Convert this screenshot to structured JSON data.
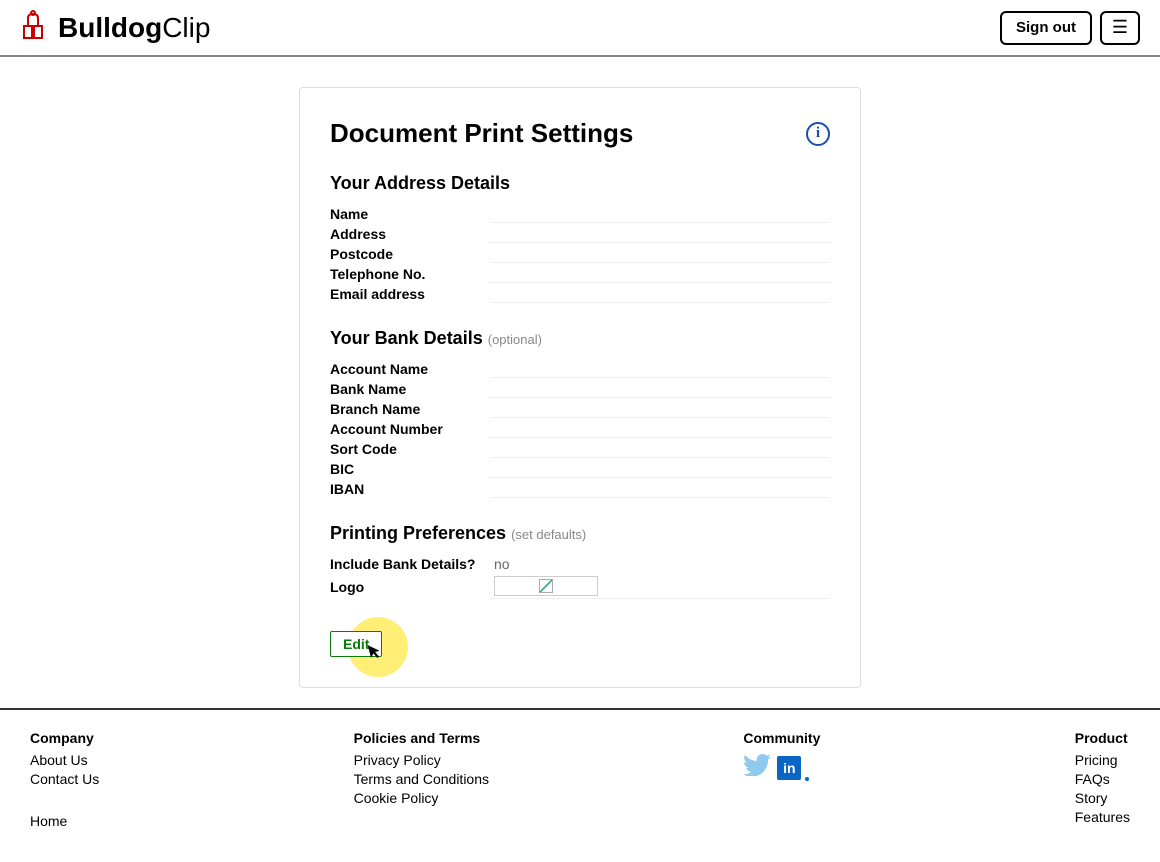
{
  "brand": {
    "bold": "Bulldog",
    "light": "Clip"
  },
  "header": {
    "signout": "Sign out"
  },
  "card": {
    "title": "Document Print Settings",
    "sections": {
      "address": {
        "title": "Your Address Details",
        "fields": {
          "name": "Name",
          "address": "Address",
          "postcode": "Postcode",
          "telephone": "Telephone No.",
          "email": "Email address"
        }
      },
      "bank": {
        "title": "Your Bank Details",
        "hint": "(optional)",
        "fields": {
          "account_name": "Account Name",
          "bank_name": "Bank Name",
          "branch_name": "Branch Name",
          "account_number": "Account Number",
          "sort_code": "Sort Code",
          "bic": "BIC",
          "iban": "IBAN"
        }
      },
      "printing": {
        "title": "Printing Preferences",
        "hint": "(set defaults)",
        "fields": {
          "include_bank": "Include Bank Details?",
          "include_bank_value": "no",
          "logo": "Logo"
        }
      }
    },
    "edit_label": "Edit"
  },
  "footer": {
    "company": {
      "title": "Company",
      "about": "About Us",
      "contact": "Contact Us",
      "home": "Home"
    },
    "policies": {
      "title": "Policies and Terms",
      "privacy": "Privacy Policy",
      "terms": "Terms and Conditions",
      "cookie": "Cookie Policy"
    },
    "community": {
      "title": "Community"
    },
    "product": {
      "title": "Product",
      "pricing": "Pricing",
      "faqs": "FAQs",
      "story": "Story",
      "features": "Features"
    }
  }
}
